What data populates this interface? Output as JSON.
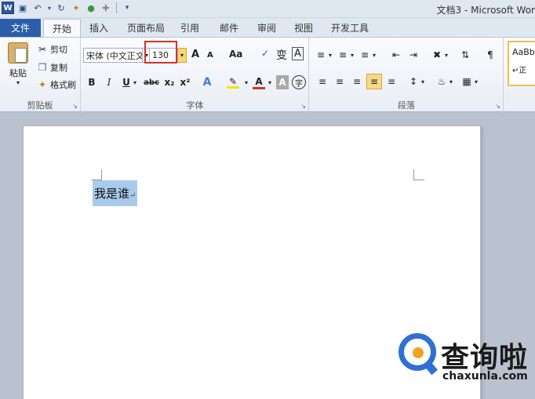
{
  "window": {
    "title": "文档3 - Microsoft Wor"
  },
  "qat": {
    "logo": "W"
  },
  "tabs": {
    "file": "文件",
    "items": [
      "开始",
      "插入",
      "页面布局",
      "引用",
      "邮件",
      "审阅",
      "视图",
      "开发工具"
    ]
  },
  "clipboard": {
    "paste": "粘贴",
    "cut": "剪切",
    "copy": "复制",
    "painter": "格式刷",
    "group_label": "剪贴板"
  },
  "font": {
    "name": "宋体 (中文正文)",
    "size": "130",
    "grow": "A",
    "shrink": "A",
    "case": "Aa",
    "bold": "B",
    "italic": "I",
    "underline": "U",
    "strike": "abc",
    "subscript": "x₂",
    "superscript": "x²",
    "text_effect": "A",
    "color": "A",
    "shading": "A",
    "enclose": "字",
    "phonetic": "变",
    "border": "A",
    "group_label": "字体"
  },
  "paragraph": {
    "group_label": "段落"
  },
  "styles": {
    "preview": "AaBb",
    "name": "正"
  },
  "document": {
    "text": "我是谁"
  },
  "watermark": {
    "title": "查询啦",
    "domain": "chaxunla.com"
  }
}
